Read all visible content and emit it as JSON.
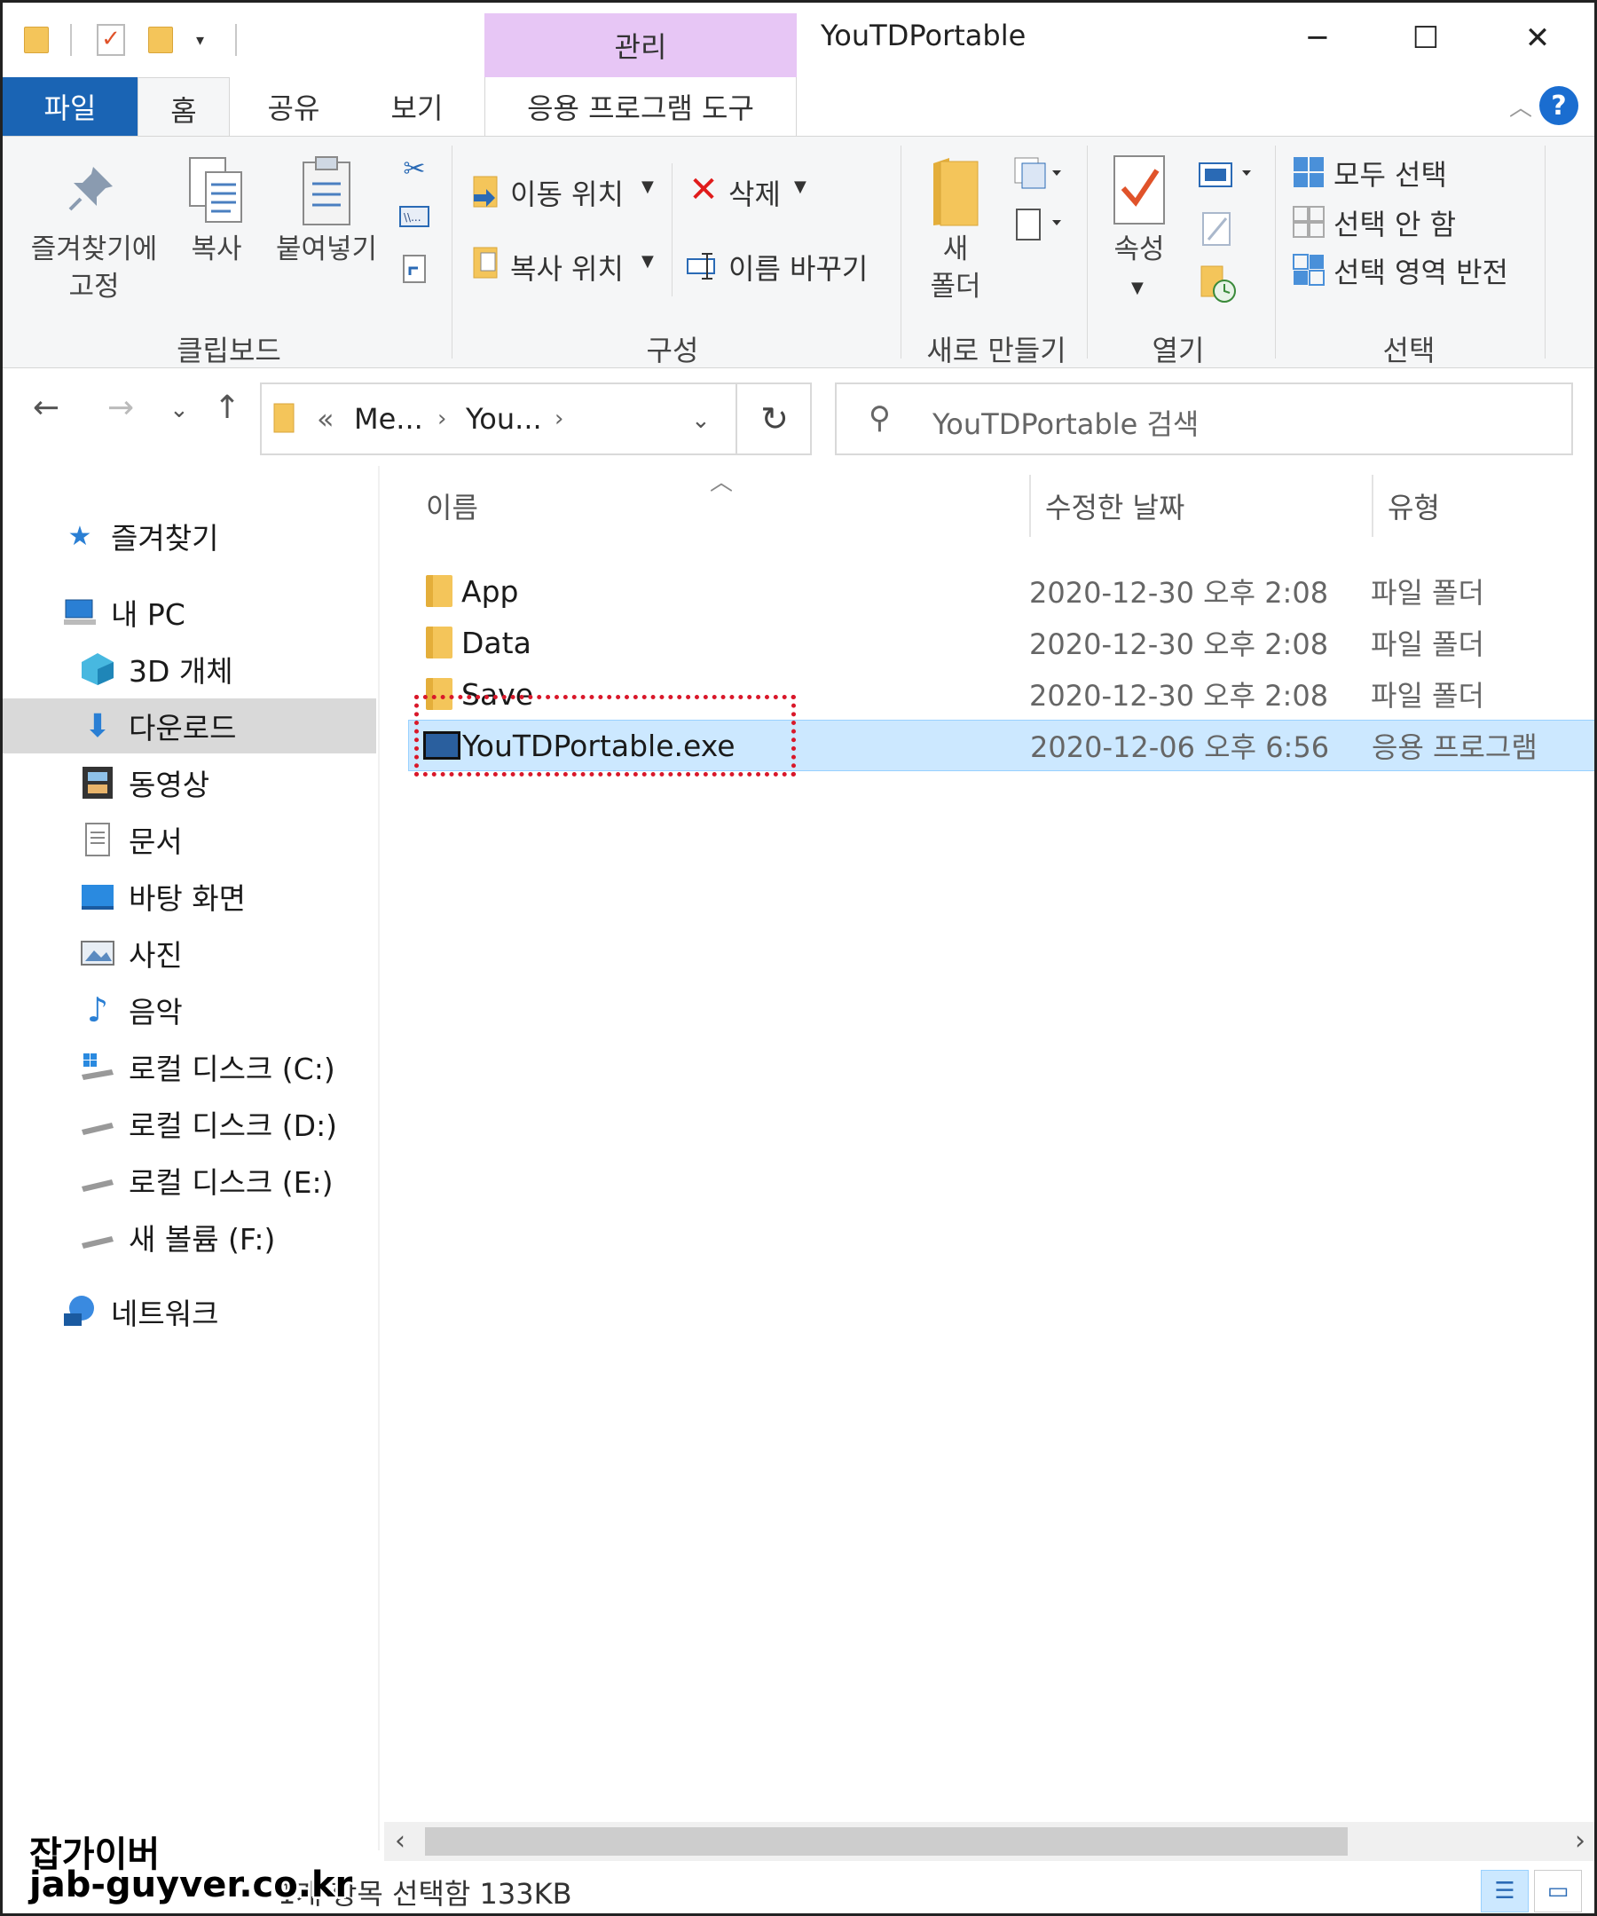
{
  "window": {
    "title": "YouTDPortable",
    "context_tab": "관리",
    "minimize": "─",
    "maximize": "☐",
    "close": "✕"
  },
  "tabs": {
    "file": "파일",
    "home": "홈",
    "share": "공유",
    "view": "보기",
    "app_tools": "응용 프로그램 도구",
    "help": "?"
  },
  "ribbon": {
    "clipboard": {
      "pin": "즐겨찾기에\n고정",
      "copy": "복사",
      "paste": "붙여넣기",
      "label": "클립보드"
    },
    "organize": {
      "move_to": "이동 위치",
      "copy_to": "복사 위치",
      "delete": "삭제",
      "rename": "이름 바꾸기",
      "label": "구성"
    },
    "new": {
      "new_folder": "새\n폴더",
      "label": "새로 만들기"
    },
    "open": {
      "properties": "속성",
      "label": "열기"
    },
    "select": {
      "select_all": "모두 선택",
      "select_none": "선택 안 함",
      "invert": "선택 영역 반전",
      "label": "선택"
    }
  },
  "address": {
    "overflow": "«",
    "segments": [
      "Me...",
      "You..."
    ],
    "search_placeholder": "YouTDPortable 검색"
  },
  "nav_pane": {
    "items": [
      {
        "label": "즐겨찾기",
        "icon": "star-icon"
      },
      {
        "label": "내 PC",
        "icon": "pc-icon"
      },
      {
        "label": "3D 개체",
        "icon": "3d-objects-icon"
      },
      {
        "label": "다운로드",
        "icon": "download-icon"
      },
      {
        "label": "동영상",
        "icon": "video-icon"
      },
      {
        "label": "문서",
        "icon": "document-icon"
      },
      {
        "label": "바탕 화면",
        "icon": "desktop-icon"
      },
      {
        "label": "사진",
        "icon": "pictures-icon"
      },
      {
        "label": "음악",
        "icon": "music-icon"
      },
      {
        "label": "로컬 디스크 (C:)",
        "icon": "drive-c-icon"
      },
      {
        "label": "로컬 디스크 (D:)",
        "icon": "drive-icon"
      },
      {
        "label": "로컬 디스크 (E:)",
        "icon": "drive-icon"
      },
      {
        "label": "새 볼륨 (F:)",
        "icon": "drive-icon"
      },
      {
        "label": "네트워크",
        "icon": "network-icon"
      }
    ]
  },
  "file_list": {
    "columns": [
      "이름",
      "수정한 날짜",
      "유형"
    ],
    "rows": [
      {
        "name": "App",
        "date": "2020-12-30 오후 2:08",
        "type": "파일 폴더",
        "icon": "folder-icon"
      },
      {
        "name": "Data",
        "date": "2020-12-30 오후 2:08",
        "type": "파일 폴더",
        "icon": "folder-icon"
      },
      {
        "name": "Save",
        "date": "2020-12-30 오후 2:08",
        "type": "파일 폴더",
        "icon": "folder-icon"
      },
      {
        "name": "YouTDPortable.exe",
        "date": "2020-12-06 오후 6:56",
        "type": "응용 프로그램",
        "icon": "exe-icon"
      }
    ]
  },
  "status": {
    "text": "1개 항목 선택함 133KB"
  },
  "watermark": {
    "line1": "잡가이버",
    "line2": "jab-guyver.co.kr"
  },
  "colors": {
    "file_tab": "#1a64b4",
    "context_tab": "#e7c6f5",
    "selection": "#cce8ff",
    "highlight_border": "#d9182a"
  }
}
